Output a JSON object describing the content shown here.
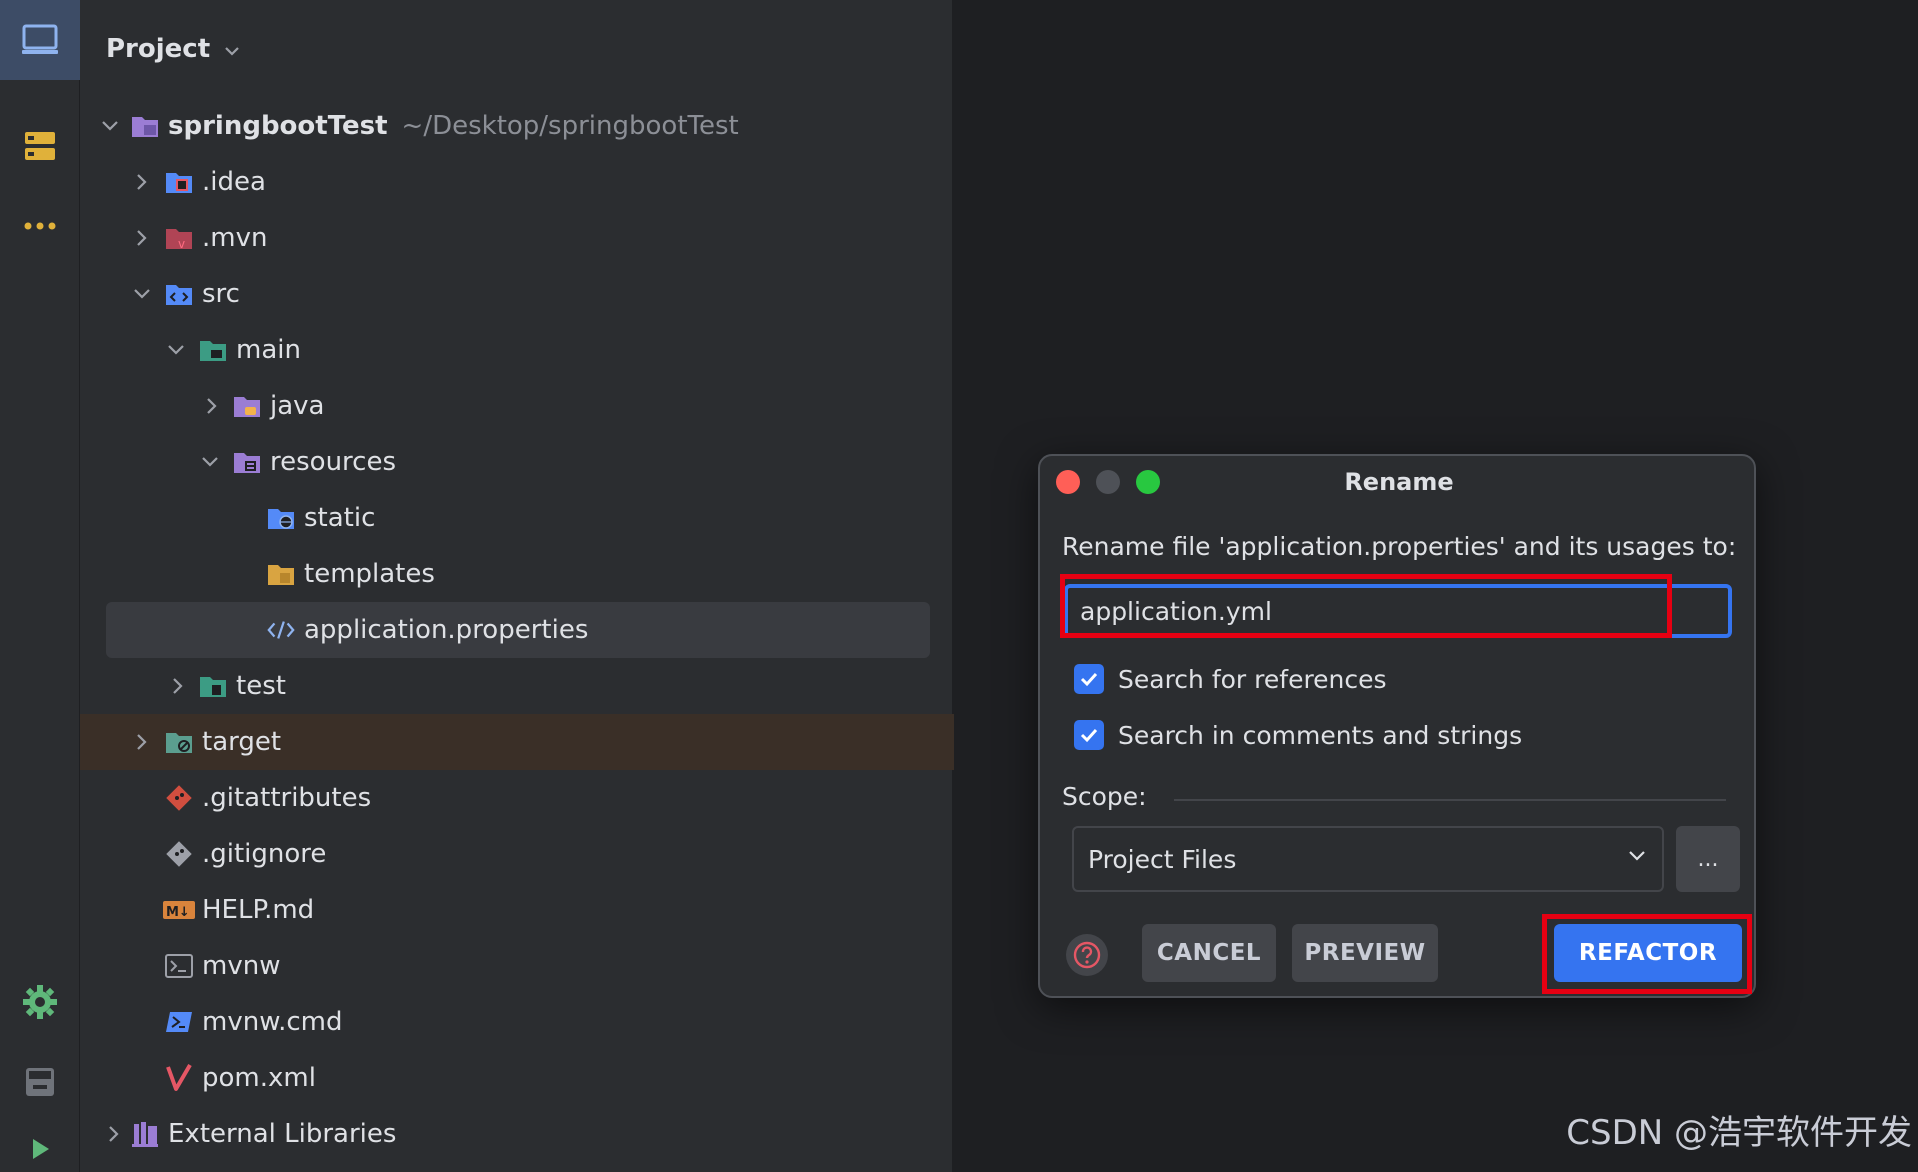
{
  "panel": {
    "title": "Project"
  },
  "tree": {
    "root": {
      "label": "springbootTest",
      "path": "~/Desktop/springbootTest"
    },
    "items": [
      {
        "label": ".idea"
      },
      {
        "label": ".mvn"
      },
      {
        "label": "src"
      },
      {
        "label": "main"
      },
      {
        "label": "java"
      },
      {
        "label": "resources"
      },
      {
        "label": "static"
      },
      {
        "label": "templates"
      },
      {
        "label": "application.properties"
      },
      {
        "label": "test"
      },
      {
        "label": "target"
      },
      {
        "label": ".gitattributes"
      },
      {
        "label": ".gitignore"
      },
      {
        "label": "HELP.md"
      },
      {
        "label": "mvnw"
      },
      {
        "label": "mvnw.cmd"
      },
      {
        "label": "pom.xml"
      },
      {
        "label": "External Libraries"
      }
    ]
  },
  "dialog": {
    "title": "Rename",
    "prompt": "Rename file 'application.properties' and its usages to:",
    "input_value": "application.yml",
    "search_references": "Search for references",
    "search_comments": "Search in comments and strings",
    "scope_label": "Scope:",
    "scope_value": "Project Files",
    "more_label": "...",
    "cancel": "CANCEL",
    "preview": "PREVIEW",
    "refactor": "REFACTOR"
  },
  "watermark": "CSDN @浩宇软件开发",
  "colors": {
    "accent": "#3574f0",
    "highlight": "#e60012",
    "background": "#1e1f22",
    "panel": "#2b2d30"
  },
  "icons": {
    "toolstrip": [
      "project-icon",
      "structure-icon",
      "more-icon",
      "settings-icon",
      "terminal-icon",
      "run-icon"
    ]
  }
}
